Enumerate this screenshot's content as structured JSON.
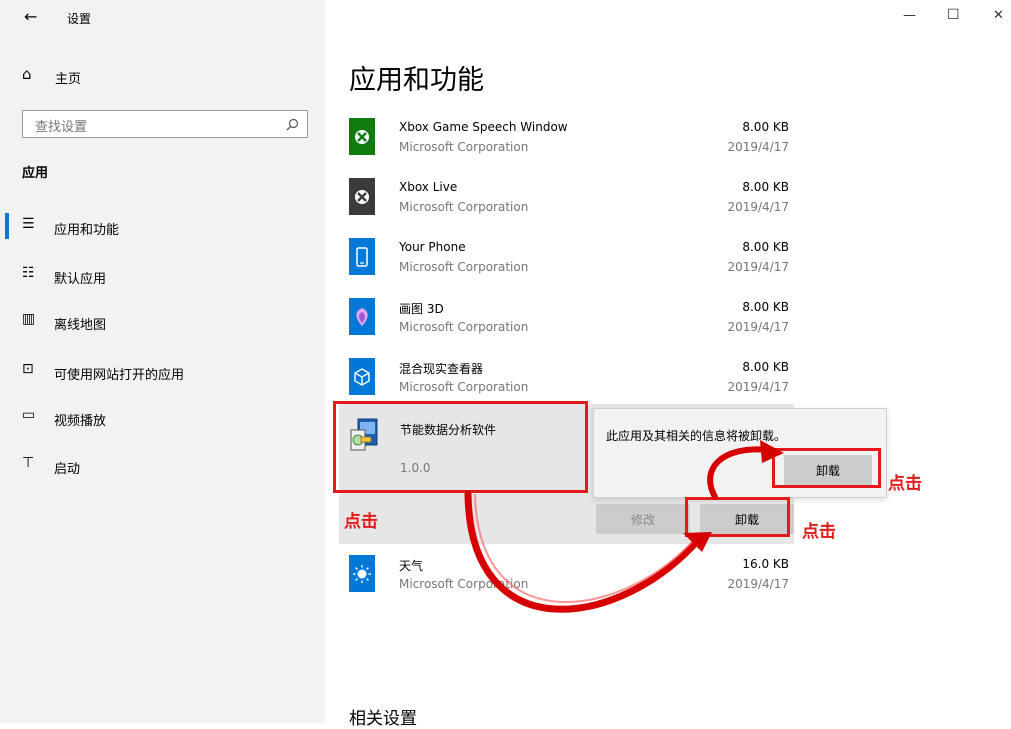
{
  "window": {
    "title": "设置",
    "controls": {
      "minimize": "—",
      "maximize": "☐",
      "close": "✕"
    }
  },
  "sidebar": {
    "home_label": "主页",
    "search_placeholder": "查找设置",
    "section_title": "应用",
    "items": [
      {
        "label": "应用和功能",
        "icon": "apps-features-icon",
        "selected": true
      },
      {
        "label": "默认应用",
        "icon": "default-apps-icon",
        "selected": false
      },
      {
        "label": "离线地图",
        "icon": "offline-maps-icon",
        "selected": false
      },
      {
        "label": "可使用网站打开的应用",
        "icon": "apps-for-websites-icon",
        "selected": false
      },
      {
        "label": "视频播放",
        "icon": "video-playback-icon",
        "selected": false
      },
      {
        "label": "启动",
        "icon": "startup-icon",
        "selected": false
      }
    ]
  },
  "main": {
    "title": "应用和功能",
    "apps": [
      {
        "name": "Xbox Game Speech Window",
        "publisher": "Microsoft Corporation",
        "size": "8.00 KB",
        "date": "2019/4/17",
        "icon_color": "#107c10",
        "icon": "xbox-icon"
      },
      {
        "name": "Xbox Live",
        "publisher": "Microsoft Corporation",
        "size": "8.00 KB",
        "date": "2019/4/17",
        "icon_color": "#3b3b3b",
        "icon": "xbox-icon"
      },
      {
        "name": "Your Phone",
        "publisher": "Microsoft Corporation",
        "size": "8.00 KB",
        "date": "2019/4/17",
        "icon_color": "#0078d7",
        "icon": "phone-icon"
      },
      {
        "name": "画图 3D",
        "publisher": "Microsoft Corporation",
        "size": "8.00 KB",
        "date": "2019/4/17",
        "icon_color": "#0078d7",
        "icon": "paint3d-icon"
      },
      {
        "name": "混合现实查看器",
        "publisher": "Microsoft Corporation",
        "size": "8.00 KB",
        "date": "2019/4/17",
        "icon_color": "#0078d7",
        "icon": "cube-icon"
      }
    ],
    "selected_app": {
      "name": "节能数据分析软件",
      "version": "1.0.0",
      "icon": "installer-icon"
    },
    "modify_label": "修改",
    "uninstall_label": "卸载",
    "after_app": {
      "name": "天气",
      "publisher": "Microsoft Corporation",
      "size": "16.0 KB",
      "date": "2019/4/17",
      "icon_color": "#0078d7",
      "icon": "weather-sun-icon"
    },
    "related_settings": "相关设置"
  },
  "flyout": {
    "message": "此应用及其相关的信息将被卸载。",
    "uninstall_label": "卸载"
  },
  "annotations": {
    "click_labels": [
      "点击",
      "点击",
      "点击"
    ],
    "color": "#e31a1a"
  }
}
